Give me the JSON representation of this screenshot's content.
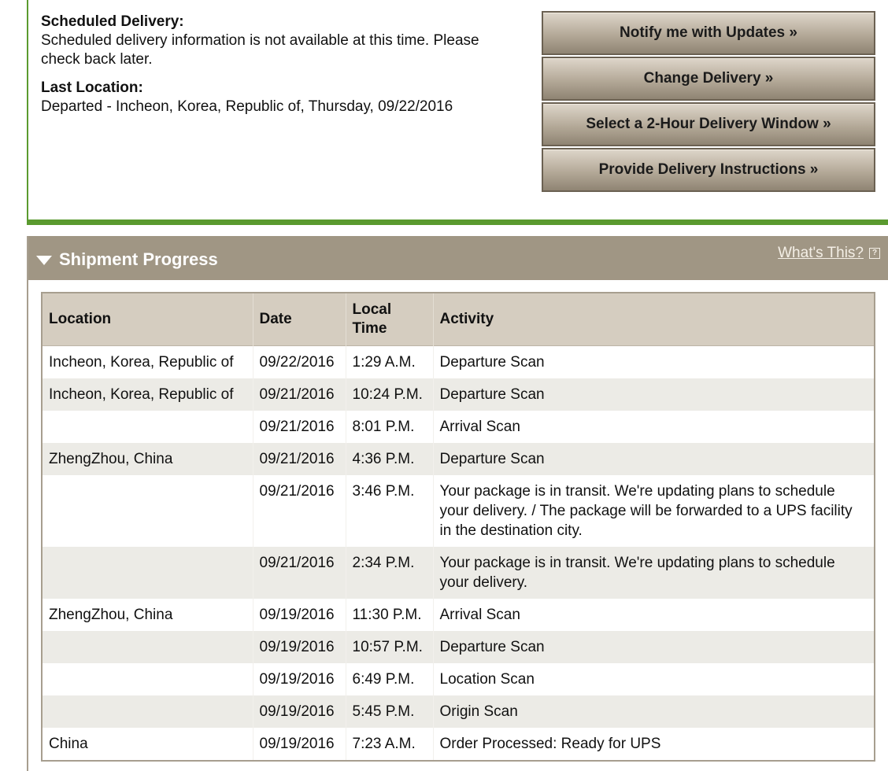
{
  "delivery": {
    "scheduled_label": "Scheduled Delivery:",
    "scheduled_text": "Scheduled delivery information is not available at this time. Please check back later.",
    "last_location_label": "Last Location:",
    "last_location_text": "Departed - Incheon, Korea, Republic of, Thursday, 09/22/2016"
  },
  "actions": {
    "notify": "Notify me with Updates »",
    "change": "Change Delivery »",
    "window": "Select a 2-Hour Delivery Window »",
    "instructions": "Provide Delivery Instructions »"
  },
  "progress": {
    "title": "Shipment Progress",
    "whats_this": "What's This?",
    "help_icon_glyph": "?",
    "columns": {
      "location": "Location",
      "date": "Date",
      "local_time": "Local Time",
      "activity": "Activity"
    },
    "rows": [
      {
        "location": "Incheon, Korea, Republic of",
        "date": "09/22/2016",
        "time": "1:29 A.M.",
        "activity": "Departure Scan"
      },
      {
        "location": "Incheon, Korea, Republic of",
        "date": "09/21/2016",
        "time": "10:24 P.M.",
        "activity": "Departure Scan"
      },
      {
        "location": "",
        "date": "09/21/2016",
        "time": "8:01 P.M.",
        "activity": "Arrival Scan"
      },
      {
        "location": "ZhengZhou, China",
        "date": "09/21/2016",
        "time": "4:36 P.M.",
        "activity": "Departure Scan"
      },
      {
        "location": "",
        "date": "09/21/2016",
        "time": "3:46 P.M.",
        "activity": "Your package is in transit. We're updating plans to schedule your delivery. / The package will be forwarded to a UPS facility in the destination city."
      },
      {
        "location": "",
        "date": "09/21/2016",
        "time": "2:34 P.M.",
        "activity": "Your package is in transit. We're updating plans to schedule your delivery."
      },
      {
        "location": "ZhengZhou, China",
        "date": "09/19/2016",
        "time": "11:30 P.M.",
        "activity": "Arrival Scan"
      },
      {
        "location": "",
        "date": "09/19/2016",
        "time": "10:57 P.M.",
        "activity": "Departure Scan"
      },
      {
        "location": "",
        "date": "09/19/2016",
        "time": "6:49 P.M.",
        "activity": "Location Scan"
      },
      {
        "location": "",
        "date": "09/19/2016",
        "time": "5:45 P.M.",
        "activity": "Origin Scan"
      },
      {
        "location": "China",
        "date": "09/19/2016",
        "time": "7:23 A.M.",
        "activity": "Order Processed: Ready for UPS"
      }
    ]
  },
  "colors": {
    "accent_green": "#5a9a2f",
    "header_brown": "#a09684",
    "table_header": "#d5cdc0",
    "row_alt": "#ecebe6"
  }
}
